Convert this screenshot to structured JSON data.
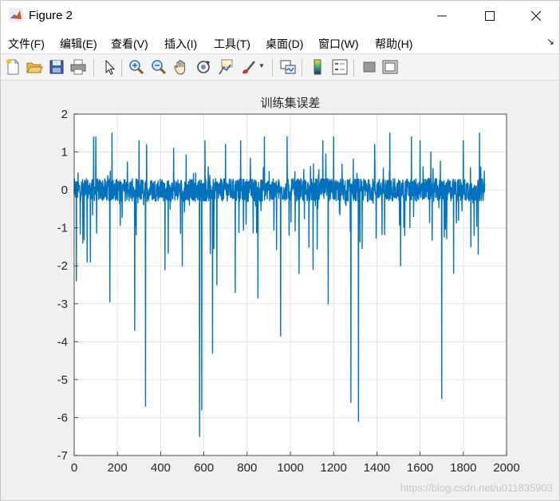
{
  "window": {
    "title": "Figure 2"
  },
  "menu": {
    "items": [
      "文件(F)",
      "编辑(E)",
      "查看(V)",
      "插入(I)",
      "工具(T)",
      "桌面(D)",
      "窗口(W)",
      "帮助(H)"
    ]
  },
  "toolbar": {
    "icons": [
      "new-figure-icon",
      "open-file-icon",
      "save-icon",
      "print-icon",
      "select-arrow-icon",
      "zoom-in-icon",
      "zoom-out-icon",
      "pan-hand-icon",
      "rotate-3d-icon",
      "data-cursor-icon",
      "brush-icon",
      "link-plot-icon",
      "colorbar-icon",
      "legend-icon",
      "hide-plot-tools-icon",
      "show-plot-tools-icon"
    ]
  },
  "watermark": "https://blog.csdn.net/u011835903",
  "chart_data": {
    "type": "line",
    "title": "训练集误差",
    "xlabel": "",
    "ylabel": "",
    "xlim": [
      0,
      2000
    ],
    "ylim": [
      -7,
      2
    ],
    "xticks": [
      "0",
      "200",
      "400",
      "600",
      "800",
      "1000",
      "1200",
      "1400",
      "1600",
      "1800",
      "2000"
    ],
    "yticks": [
      "2",
      "1",
      "0",
      "-1",
      "-2",
      "-3",
      "-4",
      "-5",
      "-6",
      "-7"
    ],
    "grid": true,
    "line_color": "#0072BD",
    "n_points": 1900,
    "series": [
      {
        "values_note": "dense noise around 0 with spikes",
        "spikes": [
          [
            10,
            -2.4
          ],
          [
            40,
            -1.4
          ],
          [
            60,
            -1.9
          ],
          [
            75,
            -1.9
          ],
          [
            90,
            1.4
          ],
          [
            100,
            1.4
          ],
          [
            165,
            -2.95
          ],
          [
            175,
            1.5
          ],
          [
            280,
            -3.7
          ],
          [
            300,
            1.3
          ],
          [
            330,
            -5.7
          ],
          [
            335,
            1.2
          ],
          [
            420,
            -2.1
          ],
          [
            460,
            1.1
          ],
          [
            500,
            -2.0
          ],
          [
            580,
            -6.5
          ],
          [
            590,
            -5.8
          ],
          [
            605,
            1.3
          ],
          [
            640,
            -4.3
          ],
          [
            660,
            -2.5
          ],
          [
            700,
            1.2
          ],
          [
            745,
            -2.7
          ],
          [
            770,
            1.3
          ],
          [
            850,
            -2.85
          ],
          [
            880,
            1.4
          ],
          [
            955,
            -3.85
          ],
          [
            985,
            1.4
          ],
          [
            1040,
            -2.2
          ],
          [
            1105,
            -2.1
          ],
          [
            1150,
            1.3
          ],
          [
            1175,
            -3.0
          ],
          [
            1200,
            1.4
          ],
          [
            1280,
            -5.6
          ],
          [
            1315,
            -6.1
          ],
          [
            1390,
            1.2
          ],
          [
            1460,
            1.5
          ],
          [
            1510,
            -2.0
          ],
          [
            1560,
            1.4
          ],
          [
            1600,
            1.3
          ],
          [
            1650,
            1.0
          ],
          [
            1700,
            -5.5
          ],
          [
            1755,
            -2.2
          ],
          [
            1800,
            1.3
          ],
          [
            1835,
            -1.5
          ],
          [
            1850,
            -1.2
          ],
          [
            1875,
            1.5
          ]
        ]
      }
    ]
  }
}
